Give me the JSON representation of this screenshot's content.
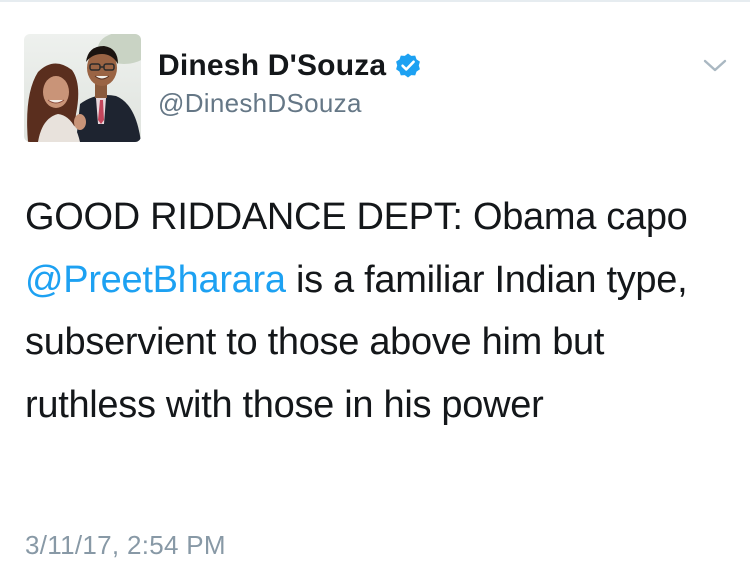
{
  "author": {
    "display_name": "Dinesh D'Souza",
    "handle": "@DineshDSouza",
    "verified": true,
    "avatar_icon": "profile-photo"
  },
  "menu": {
    "icon": "chevron-down-icon"
  },
  "tweet": {
    "text_part1": "GOOD RIDDANCE DEPT: Obama capo ",
    "mention": "@PreetBharara",
    "text_part2": " is a familiar Indian type, subservient to those above him but ruthless with those in his power",
    "timestamp": "3/11/17, 2:54 PM"
  },
  "colors": {
    "text": "#14171a",
    "secondary": "#657786",
    "timestamp": "#8899a6",
    "link": "#1da1f2",
    "verified": "#1da1f2",
    "chevron": "#aab8c2"
  }
}
